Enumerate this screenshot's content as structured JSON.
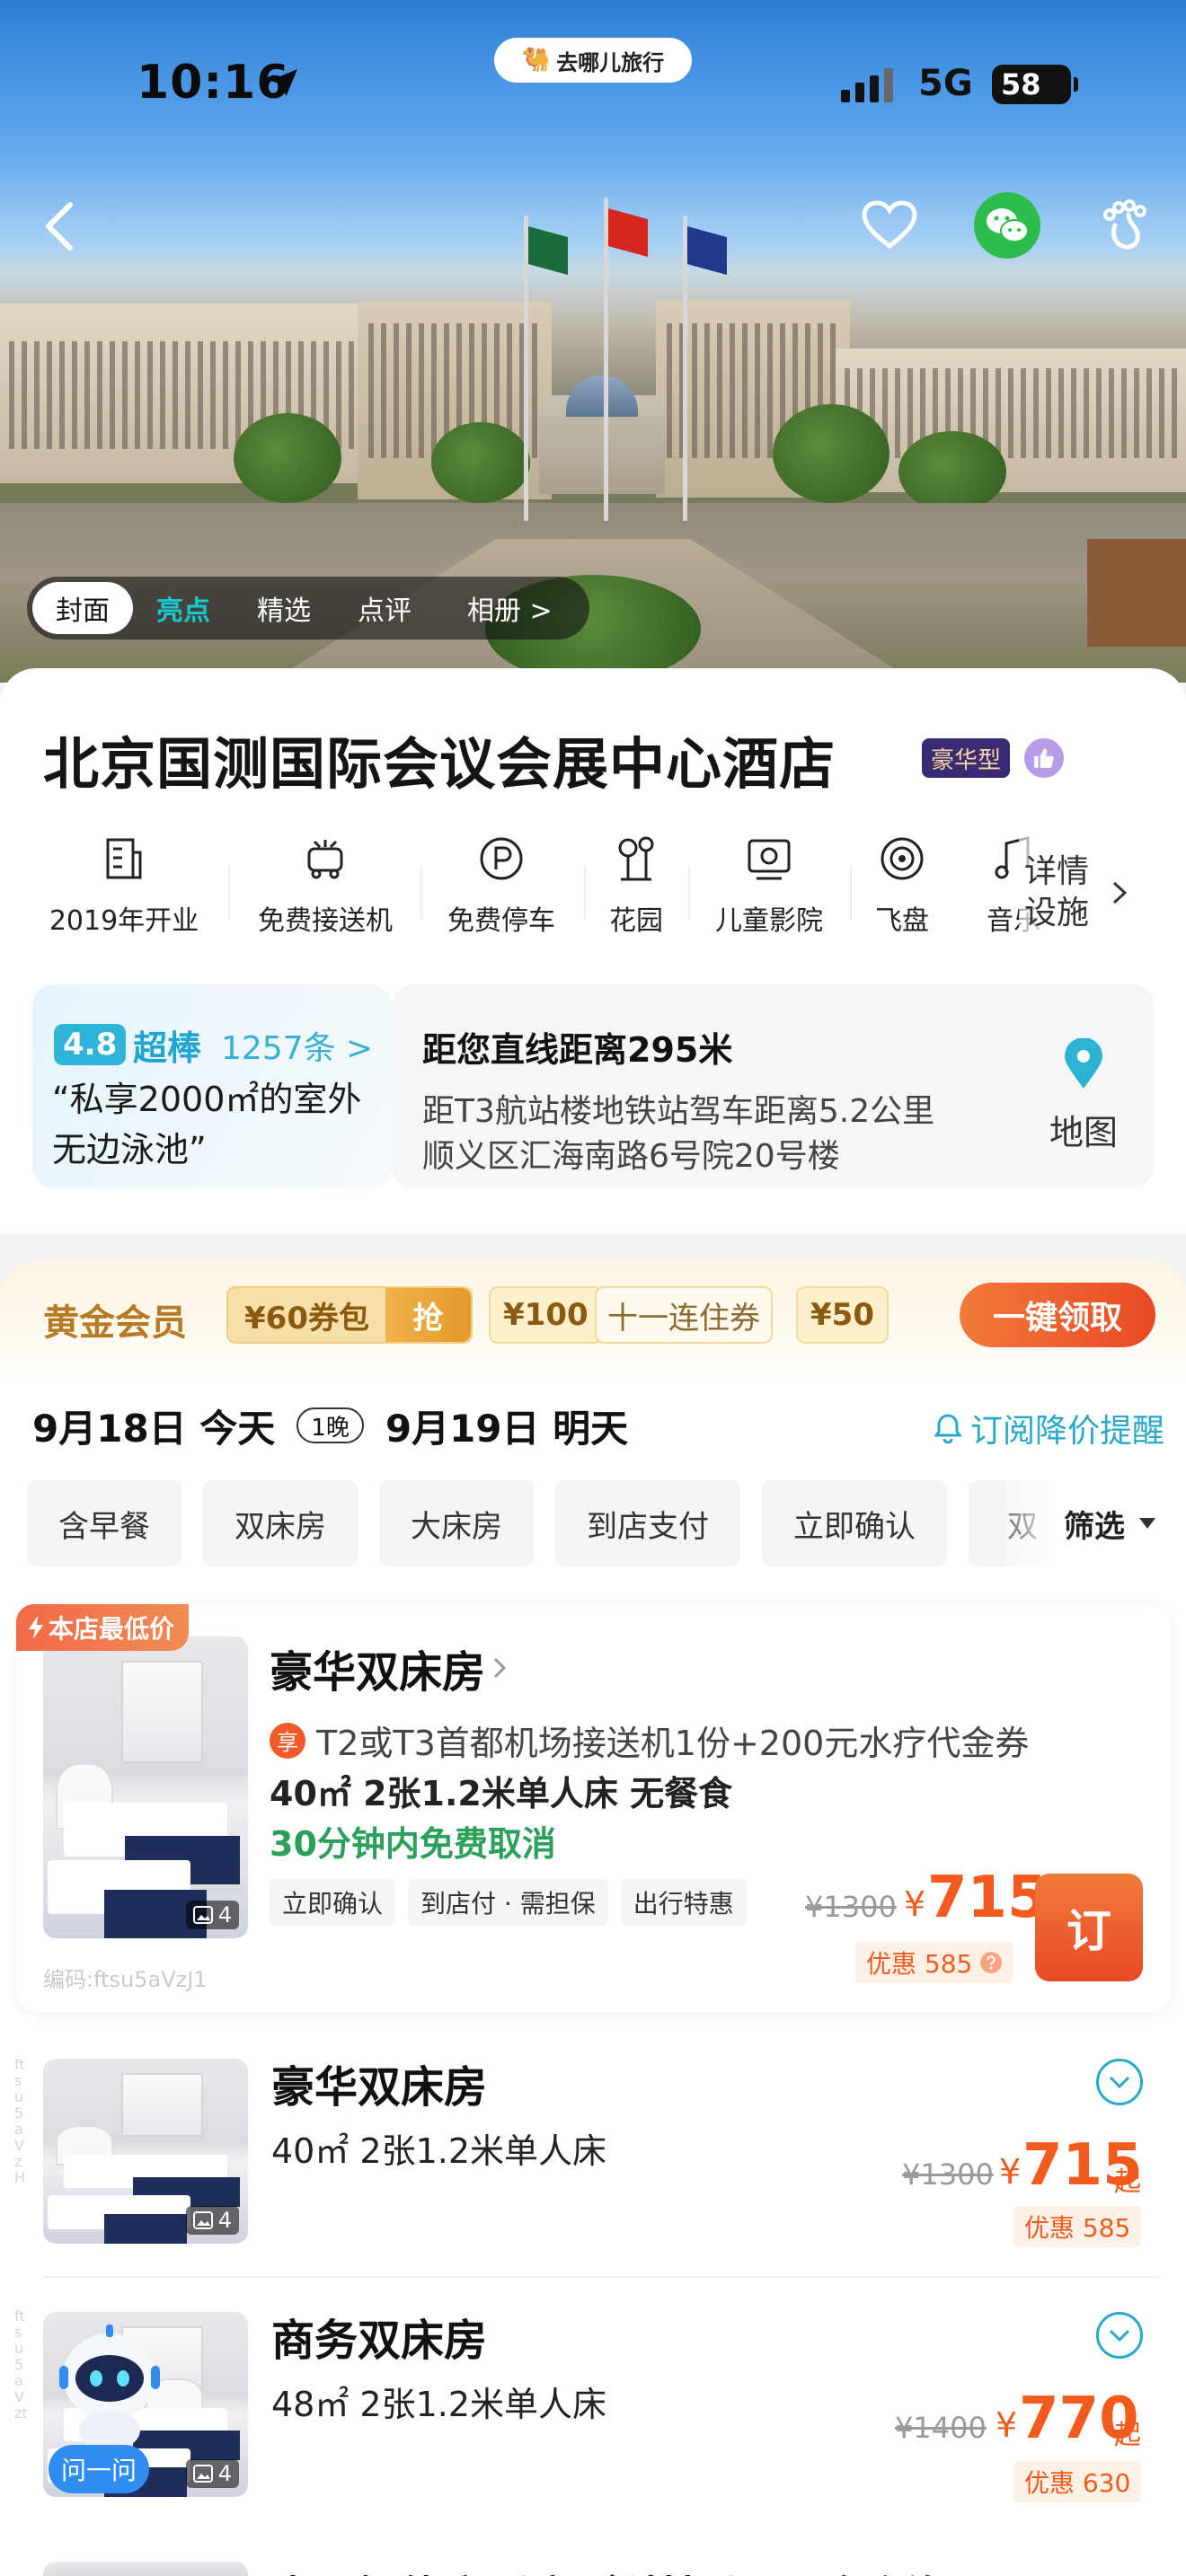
{
  "status_bar": {
    "time": "10:16",
    "network": "5G",
    "battery": "58"
  },
  "brand": {
    "name": "去哪儿旅行"
  },
  "photo_tabs": [
    {
      "label": "封面"
    },
    {
      "label": "亮点"
    },
    {
      "label": "精选"
    },
    {
      "label": "点评"
    },
    {
      "label": "相册 >"
    }
  ],
  "hotel": {
    "name": "北京国测国际会议会展中心酒店",
    "star_label": "豪华型"
  },
  "facilities": [
    {
      "label": "2019年开业",
      "icon": "building-icon"
    },
    {
      "label": "免费接送机",
      "icon": "shuttle-icon"
    },
    {
      "label": "免费停车",
      "icon": "parking-icon"
    },
    {
      "label": "花园",
      "icon": "garden-icon"
    },
    {
      "label": "儿童影院",
      "icon": "cinema-icon"
    },
    {
      "label": "飞盘",
      "icon": "frisbee-icon"
    },
    {
      "label": "音乐",
      "icon": "music-icon"
    }
  ],
  "facility_detail": "详情设施",
  "review": {
    "score": "4.8",
    "word": "超棒",
    "count": "1257条 >",
    "quote": "“私享2000㎡的室外无边泳池”"
  },
  "location": {
    "distance": "距您直线距离295米",
    "transit": "距T3航站楼地铁站驾车距离5.2公里",
    "address": "顺义区汇海南路6号院20号楼",
    "map_label": "地图"
  },
  "member": {
    "title": "黄金会员",
    "pack_label": "¥60券包",
    "grab_label": "抢",
    "c100": "¥100",
    "streak": "十一连住券",
    "c50": "¥50",
    "claim": "一键领取"
  },
  "dates": {
    "checkin": "9月18日 今天",
    "nights": "1晚",
    "checkout": "9月19日 明天",
    "subscribe": "订阅降价提醒"
  },
  "filters": [
    "含早餐",
    "双床房",
    "大床房",
    "到店支付",
    "立即确认",
    "双"
  ],
  "filter_more": "筛选",
  "featured_room": {
    "tag": "本店最低价",
    "name": "豪华双床房",
    "perk": "T2或T3首都机场接送机1份+200元水疗代金券",
    "perk_badge": "享",
    "specs": "40㎡  2张1.2米单人床  无餐食",
    "cancel": "30分钟内免费取消",
    "tags": [
      "立即确认",
      "到店付 · 需担保",
      "出行特惠"
    ],
    "code": "编码:ftsu5aVzJ1",
    "image_count": "4",
    "old_price": "¥1300",
    "currency": "¥",
    "price": "715",
    "discount": "优惠 585",
    "book": "订"
  },
  "rooms": [
    {
      "name": "豪华双床房",
      "specs": "40㎡  2张1.2米单人床",
      "old_price": "¥1300",
      "currency": "¥",
      "price": "715",
      "suffix": "起",
      "discount": "优惠 585",
      "image_count": "4",
      "code": "ftsu5aVzH"
    },
    {
      "name": "商务双床房",
      "specs": "48㎡  2张1.2米单人床",
      "old_price": "¥1400",
      "currency": "¥",
      "price": "770",
      "suffix": "起",
      "discount": "优惠 630",
      "image_count": "4",
      "code": "ftsu5aVzt"
    }
  ],
  "assistant": {
    "label": "问一问"
  },
  "next_room_peek": "米阳智能高睡床（科技叶阳，舒缓解压"
}
